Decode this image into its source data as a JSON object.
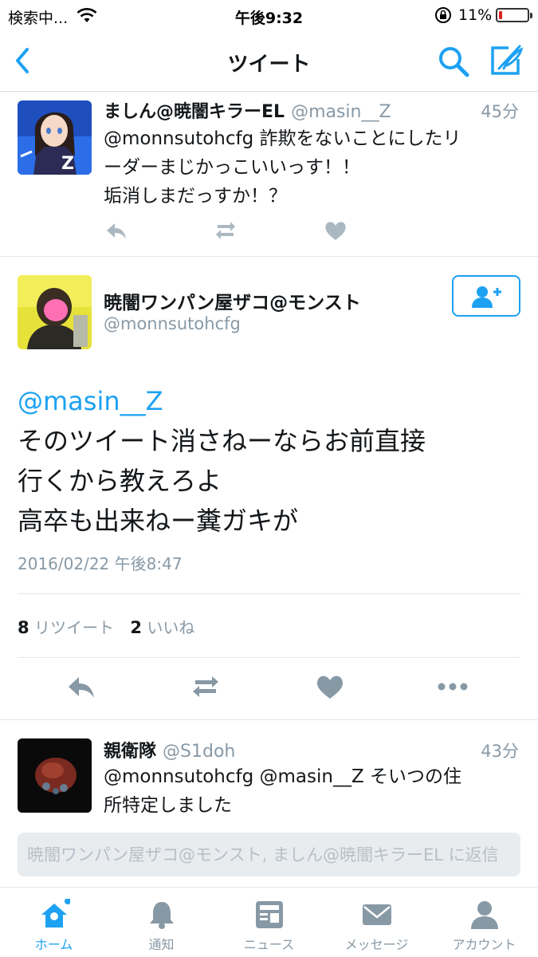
{
  "status_bar": {
    "carrier": "検索中...",
    "time": "午後9:32",
    "battery_percent": "11%",
    "battery_level": 0.11
  },
  "nav": {
    "title": "ツイート"
  },
  "reply_tweet_1": {
    "name": "ましん@暁闇キラーEL",
    "handle": "@masin__Z",
    "time": "45分",
    "text_lines": [
      "@monnsutohcfg 詐欺をないことにしたリ",
      "ーダーまじかっこいいっす！！",
      "垢消しまだっすか！？"
    ]
  },
  "main_tweet": {
    "name": "暁闇ワンパン屋ザコ@モンスト",
    "handle": "@monnsutohcfg",
    "mention": "@masin__Z",
    "lines": [
      "そのツイート消さねーならお前直接",
      "行くから教えろよ",
      "高卒も出来ねー糞ガキが"
    ],
    "datetime": "2016/02/22 午後8:47",
    "retweet_count": "8",
    "retweet_label": "リツイート",
    "like_count": "2",
    "like_label": "いいね"
  },
  "reply_tweet_2": {
    "name": "親衛隊",
    "handle": "@S1doh",
    "time": "43分",
    "text_lines": [
      "@monnsutohcfg @masin__Z そいつの住",
      "所特定しました"
    ]
  },
  "reply_box": {
    "placeholder": "暁闇ワンパン屋ザコ@モンスト, ましん@暁闇キラーEL に返信"
  },
  "tabs": [
    {
      "label": "ホーム",
      "icon": "home-icon"
    },
    {
      "label": "通知",
      "icon": "bell-icon"
    },
    {
      "label": "ニュース",
      "icon": "news-icon"
    },
    {
      "label": "メッセージ",
      "icon": "message-icon"
    },
    {
      "label": "アカウント",
      "icon": "account-icon"
    }
  ],
  "colors": {
    "accent": "#1da1f2",
    "muted": "#8899a6",
    "text": "#14171a",
    "battery_low": "#e0211b"
  }
}
